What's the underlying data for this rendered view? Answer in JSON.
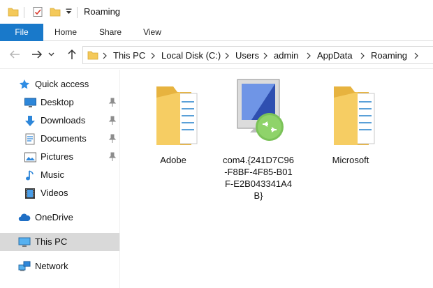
{
  "window": {
    "title": "Roaming"
  },
  "ribbon": {
    "tabs": [
      {
        "label": "File"
      },
      {
        "label": "Home"
      },
      {
        "label": "Share"
      },
      {
        "label": "View"
      }
    ]
  },
  "address_bar": {
    "breadcrumbs": [
      "This PC",
      "Local Disk (C:)",
      "Users",
      "admin",
      "AppData",
      "Roaming"
    ]
  },
  "sidebar": {
    "quick_access": "Quick access",
    "items": [
      {
        "label": "Desktop",
        "icon": "desktop-icon",
        "pinned": true
      },
      {
        "label": "Downloads",
        "icon": "downloads-icon",
        "pinned": true
      },
      {
        "label": "Documents",
        "icon": "documents-icon",
        "pinned": true
      },
      {
        "label": "Pictures",
        "icon": "pictures-icon",
        "pinned": true
      },
      {
        "label": "Music",
        "icon": "music-icon",
        "pinned": false
      },
      {
        "label": "Videos",
        "icon": "videos-icon",
        "pinned": false
      }
    ],
    "onedrive": "OneDrive",
    "this_pc": "This PC",
    "network": "Network",
    "selected": "This PC"
  },
  "files": [
    {
      "name": "Adobe",
      "icon": "folder-icon"
    },
    {
      "name": "com4.{241D7C96-F8BF-4F85-B01F-E2B043341A4B}",
      "icon": "remote-desktop-icon"
    },
    {
      "name": "Microsoft",
      "icon": "folder-icon"
    }
  ],
  "colors": {
    "accent": "#1979ca",
    "folder": "#f4c95a",
    "selected_bg": "#d9d9d9"
  }
}
